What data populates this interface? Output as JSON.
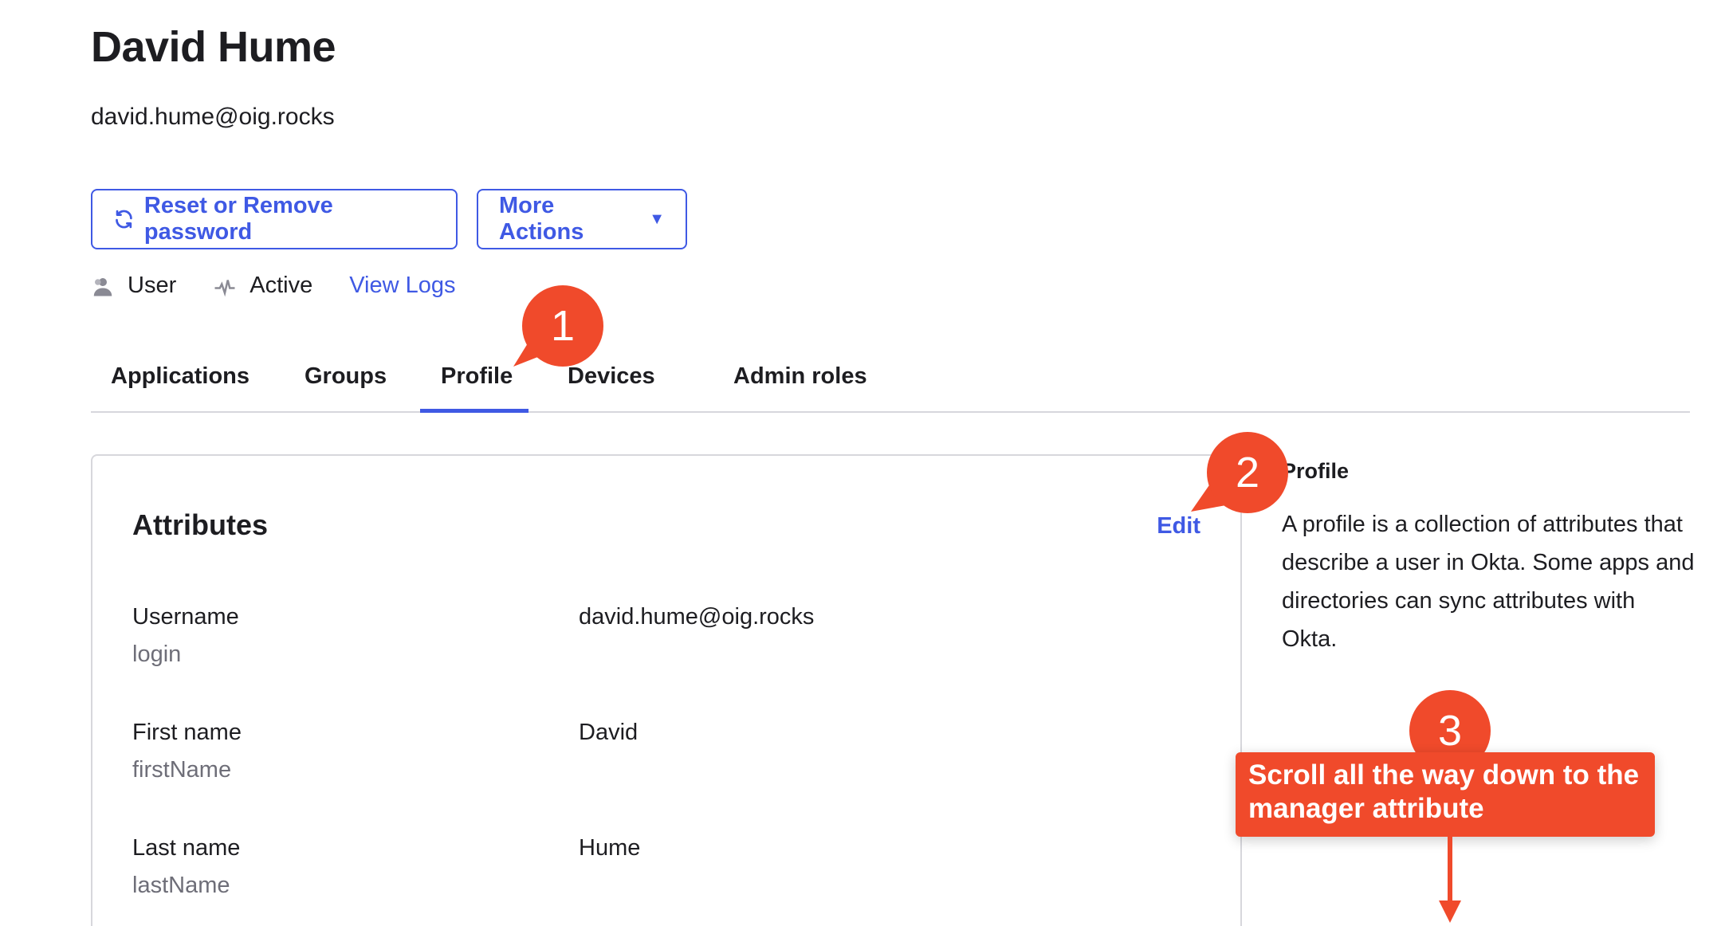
{
  "user": {
    "name": "David Hume",
    "email": "david.hume@oig.rocks"
  },
  "actions": {
    "reset_label": "Reset or Remove password",
    "more_label": "More Actions",
    "more_caret": "▼"
  },
  "meta": {
    "type_label": "User",
    "status_label": "Active",
    "logs_label": "View Logs"
  },
  "tabs": [
    {
      "label": "Applications"
    },
    {
      "label": "Groups"
    },
    {
      "label": "Profile",
      "active": true
    },
    {
      "label": "Devices"
    },
    {
      "label": "Admin roles"
    }
  ],
  "attributes": {
    "title": "Attributes",
    "edit_label": "Edit",
    "rows": [
      {
        "label": "Username",
        "key": "login",
        "value": "david.hume@oig.rocks"
      },
      {
        "label": "First name",
        "key": "firstName",
        "value": "David"
      },
      {
        "label": "Last name",
        "key": "lastName",
        "value": "Hume"
      }
    ]
  },
  "sidebar": {
    "title": "Profile",
    "text": "A profile is a collection of attributes that describe a user in Okta. Some apps and directories can sync attributes with Okta."
  },
  "annotations": {
    "step1": "1",
    "step2": "2",
    "step3": "3",
    "callout_text": "Scroll all the way down to the manager attribute"
  },
  "colors": {
    "accent": "#3f59e4",
    "annotation": "#f04a2b",
    "border": "#d7d7dc",
    "muted_text": "#6e6e78"
  }
}
